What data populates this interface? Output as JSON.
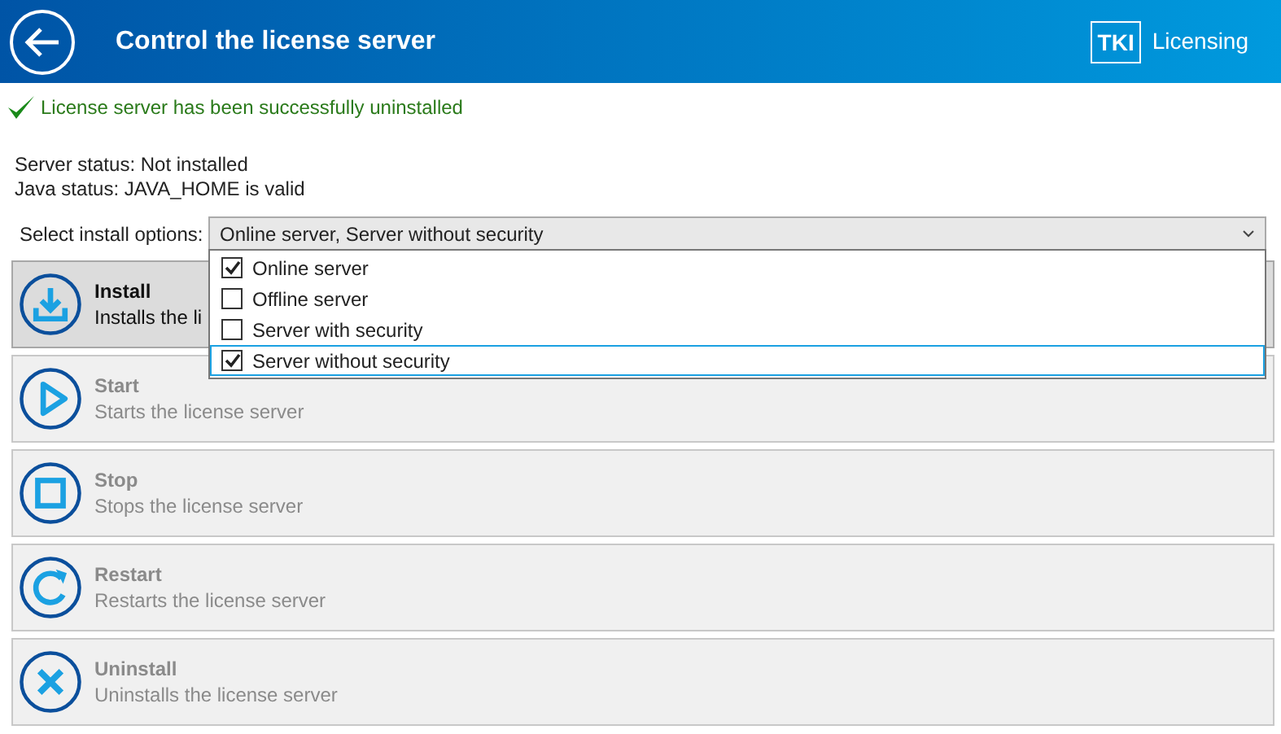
{
  "header": {
    "title": "Control the license server",
    "logo_mark": "TKI",
    "logo_text": "Licensing"
  },
  "message": {
    "text": "License server has been successfully uninstalled",
    "kind": "success"
  },
  "status_lines": [
    "Server status: Not installed",
    "Java status: JAVA_HOME is valid"
  ],
  "install_options": {
    "label": "Select install options:",
    "value": "Online server, Server without security",
    "expanded": true,
    "options": [
      {
        "label": "Online server",
        "checked": true,
        "highlighted": false
      },
      {
        "label": "Offline server",
        "checked": false,
        "highlighted": false
      },
      {
        "label": "Server with security",
        "checked": false,
        "highlighted": false
      },
      {
        "label": "Server without security",
        "checked": true,
        "highlighted": true
      }
    ]
  },
  "actions": [
    {
      "kind": "install",
      "title": "Install",
      "description": "Installs the li",
      "disabled": false
    },
    {
      "kind": "start",
      "title": "Start",
      "description": "Starts the license server",
      "disabled": true
    },
    {
      "kind": "stop",
      "title": "Stop",
      "description": "Stops the license server",
      "disabled": true
    },
    {
      "kind": "restart",
      "title": "Restart",
      "description": "Restarts the license server",
      "disabled": true
    },
    {
      "kind": "uninstall",
      "title": "Uninstall",
      "description": "Uninstalls the license server",
      "disabled": true
    }
  ]
}
